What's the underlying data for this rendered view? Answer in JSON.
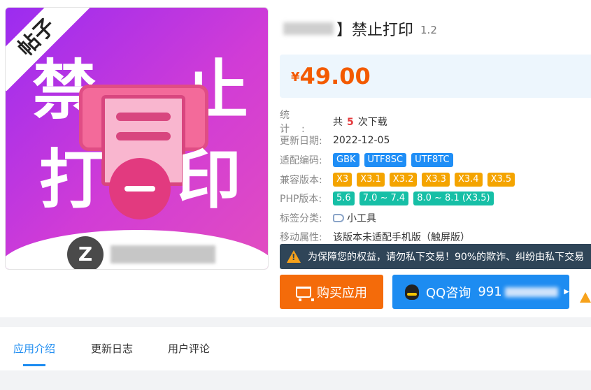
{
  "product": {
    "title": "】禁止打印",
    "version": "1.2",
    "image": {
      "ribbon_text": "帖子",
      "chars": [
        "禁",
        "止",
        "打",
        "印"
      ],
      "logo_letter": "Z"
    }
  },
  "price": {
    "currency": "¥",
    "amount": "49.00"
  },
  "info": {
    "stats": {
      "label": "统计:",
      "prefix": "共",
      "count": "5",
      "suffix": "次下载"
    },
    "updated": {
      "label": "更新日期:",
      "value": "2022-12-05"
    },
    "encoding": {
      "label": "适配编码:",
      "tags": [
        "GBK",
        "UTF8SC",
        "UTF8TC"
      ]
    },
    "compat": {
      "label": "兼容版本:",
      "tags": [
        "X3",
        "X3.1",
        "X3.2",
        "X3.3",
        "X3.4",
        "X3.5"
      ]
    },
    "php": {
      "label": "PHP版本:",
      "tags": [
        "5.6",
        "7.0 ~ 7.4",
        "8.0 ~ 8.1 (X3.5)"
      ]
    },
    "category": {
      "label": "标签分类:",
      "value": "小工具"
    },
    "mobile": {
      "label": "移动属性:",
      "value": "该版本未适配手机版（触屏版）"
    }
  },
  "warning": {
    "text": "为保障您的权益，请勿私下交易！90%的欺诈、纠纷由私下交易"
  },
  "buttons": {
    "buy": "购买应用",
    "qq_prefix": "QQ咨询",
    "qq_visible_digits": "991"
  },
  "tabs": [
    {
      "label": "应用介绍",
      "active": true
    },
    {
      "label": "更新日志",
      "active": false
    },
    {
      "label": "用户评论",
      "active": false
    }
  ],
  "colors": {
    "price": "#f35a00",
    "buy_button": "#f46b0a",
    "qq_button": "#1d8cf1",
    "tag_blue": "#1f8ef6",
    "tag_orange": "#f4a400",
    "tag_teal": "#16bfa6",
    "warning_bg": "#2f4558"
  }
}
